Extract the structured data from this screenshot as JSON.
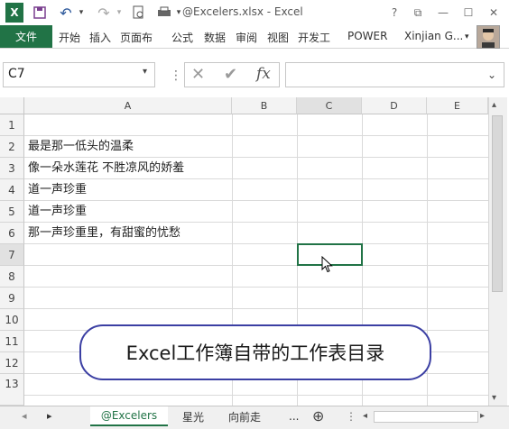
{
  "app": {
    "title": "@Excelers.xlsx - Excel",
    "excel_logo": "X",
    "accent": "#217346",
    "icons": [
      "excel-logo-icon",
      "save-icon",
      "undo-icon",
      "redo-icon",
      "print-preview-icon",
      "print-icon",
      "qat-more-icon"
    ]
  },
  "window_buttons": {
    "help": "?",
    "restore": "⧉",
    "minimize": "—",
    "maximize": "☐",
    "close": "✕"
  },
  "ribbon": {
    "file_tab": "文件",
    "tabs": [
      "开始",
      "插入",
      "页面布",
      "公式",
      "数据",
      "审阅",
      "视图",
      "开发工",
      "POWER"
    ],
    "user": "Xinjian G...",
    "user_caret": "▾"
  },
  "formula_bar": {
    "name_box": "C7",
    "name_box_arrow": "▾",
    "separator": "⋮",
    "cancel": "✕",
    "enter": "✔",
    "fx": "fx",
    "formula": "",
    "expand": "⌄"
  },
  "sheet": {
    "columns": [
      "A",
      "B",
      "C",
      "D",
      "E"
    ],
    "rows": [
      "1",
      "2",
      "3",
      "4",
      "5",
      "6",
      "7",
      "8",
      "9",
      "10",
      "11",
      "12",
      "13"
    ],
    "cells": {
      "A1": "",
      "A2": "最是那一低头的温柔",
      "A3": "像一朵水莲花 不胜凉风的娇羞",
      "A4": "道一声珍重",
      "A5": "道一声珍重",
      "A6": "那一声珍重里，有甜蜜的忧愁"
    }
  },
  "callout": {
    "text": "Excel工作簿自带的工作表目录"
  },
  "sheet_tabs": {
    "nav_prev": "◂",
    "nav_next": "▸",
    "tabs": [
      "@Excelers",
      "星光",
      "向前走"
    ],
    "more": "...",
    "add": "⊕",
    "scroll_sep": "⋮"
  },
  "scrollbar": {
    "up": "▴",
    "down": "▾",
    "left": "◂",
    "right": "▸"
  }
}
